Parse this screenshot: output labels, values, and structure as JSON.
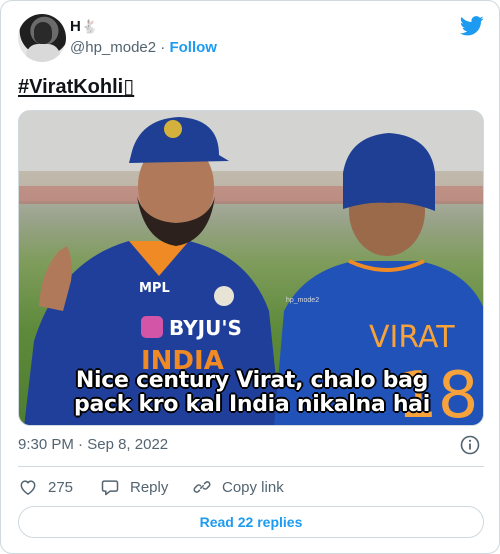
{
  "author": {
    "display_name": "H",
    "name_emoji": "🐇",
    "handle": "@hp_mode2",
    "separator": "·",
    "follow_label": "Follow"
  },
  "tweet": {
    "text": "#ViratKohli",
    "text_suffix_glyph": "▯"
  },
  "media": {
    "caption_line1": "Nice century Virat, chalo bag",
    "caption_line2": "pack kro kal India nikalna hai",
    "watermark": "hp_mode2",
    "jersey_text_left": "BYJU'S",
    "jersey_india": "INDIA",
    "jersey_mpl": "MPL",
    "jersey_name_right": "VIRAT",
    "jersey_number_right": "18"
  },
  "meta": {
    "time": "9:30 PM",
    "dot": "·",
    "date": "Sep 8, 2022"
  },
  "actions": {
    "like_count": "275",
    "reply_label": "Reply",
    "copy_link_label": "Copy link"
  },
  "read_replies_label": "Read 22 replies",
  "colors": {
    "brand_blue": "#1d9bf0",
    "text_primary": "#0f1419",
    "text_secondary": "#536471",
    "border": "#cfd9de"
  },
  "icons": {
    "brand": "twitter-bird-icon",
    "info": "info-icon",
    "like": "heart-icon",
    "reply": "speech-bubble-icon",
    "copy_link": "link-icon"
  }
}
